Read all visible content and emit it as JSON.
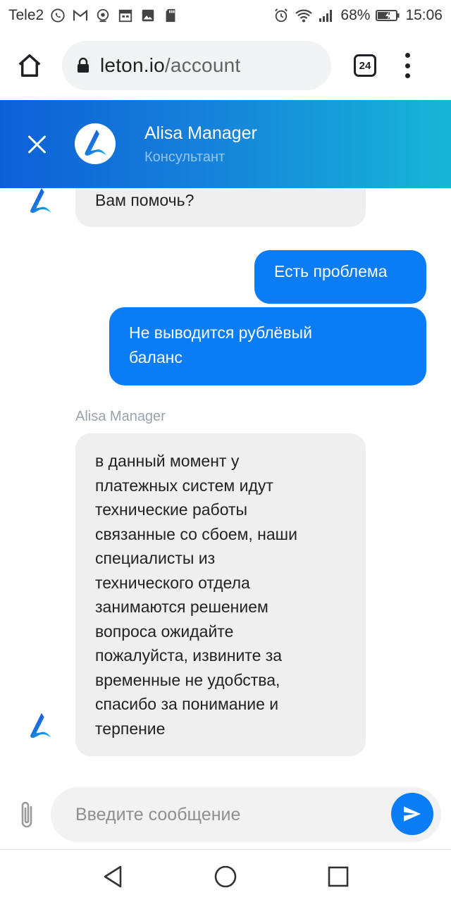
{
  "status_bar": {
    "carrier": "Tele2",
    "battery": "68%",
    "time": "15:06",
    "icons_left": [
      "whatsapp-icon",
      "gmail-icon",
      "camera-icon",
      "calendar-icon",
      "gallery-icon",
      "sd-card-icon"
    ],
    "icons_right": [
      "alarm-icon",
      "wifi-icon",
      "signal-icon",
      "battery-icon"
    ]
  },
  "browser": {
    "url_domain": "leton.io",
    "url_path": "/account",
    "tab_count": "24"
  },
  "chat_header": {
    "agent_name": "Alisa Manager",
    "agent_role": "Консультант",
    "brand_color": "#0d5fd6",
    "accent_color": "#17b6d6"
  },
  "messages": [
    {
      "from": "agent",
      "text": "Вам помочь?"
    },
    {
      "from": "user",
      "text": "Есть проблема"
    },
    {
      "from": "user",
      "lines": [
        "Не выводится рублёвый",
        "баланс"
      ]
    },
    {
      "from": "agent",
      "sender": "Alisa Manager",
      "lines": [
        "в данный момент у",
        "платежных систем идут",
        "технические работы",
        "связанные со сбоем, наши",
        "специалисты из",
        "технического отдела",
        "занимаются решением",
        "вопроса ожидайте",
        "пожалуйста, извините за",
        "временные не удобства,",
        "спасибо за понимание и",
        "терпение"
      ]
    }
  ],
  "input": {
    "placeholder": "Введите сообщение",
    "value": ""
  },
  "colors": {
    "user_bubble": "#0a7cf5",
    "agent_bubble": "#efefef"
  }
}
